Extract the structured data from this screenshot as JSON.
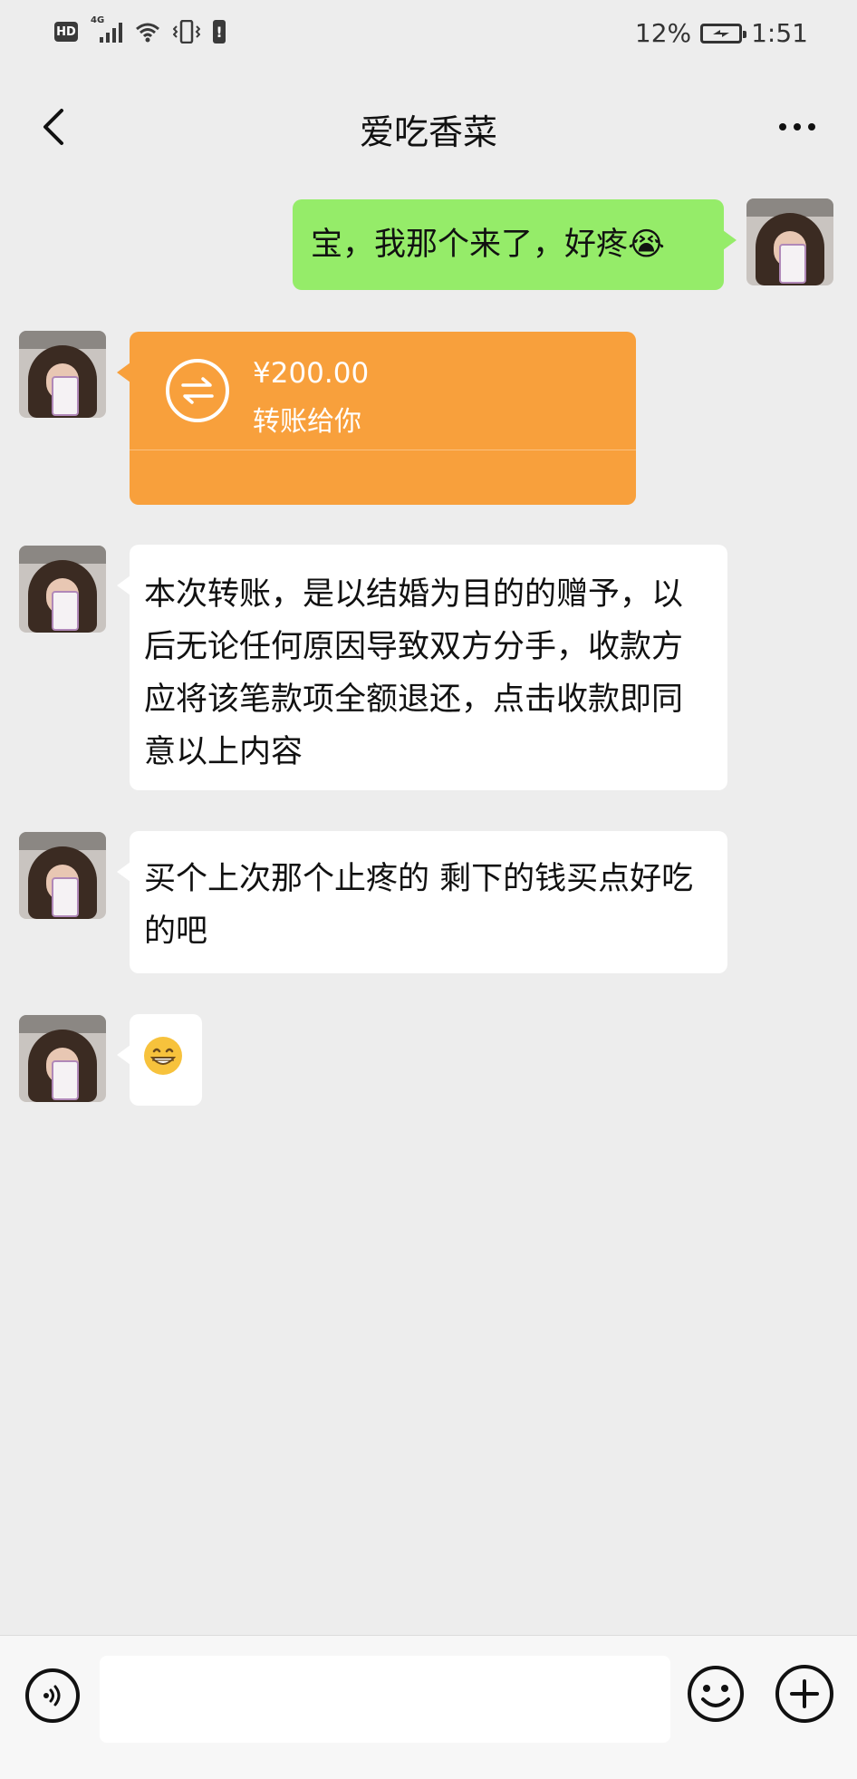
{
  "status_bar": {
    "network_badge": "HD",
    "signal_label": "4G",
    "battery_percent": "12%",
    "time": "1:51"
  },
  "nav": {
    "title": "爱吃香菜"
  },
  "messages": [
    {
      "sender": "me",
      "type": "text",
      "text": "宝，我那个来了，好疼😭"
    },
    {
      "sender": "other",
      "type": "transfer",
      "amount": "¥200.00",
      "note": "转账给你"
    },
    {
      "sender": "other",
      "type": "text",
      "text": "本次转账，是以结婚为目的的赠予，以后无论任何原因导致双方分手，收款方应将该笔款项全额退还，点击收款即同意以上内容"
    },
    {
      "sender": "other",
      "type": "text",
      "text": "买个上次那个止疼的 剩下的钱买点好吃的吧"
    },
    {
      "sender": "other",
      "type": "emoji",
      "icon": "grinning-face-emoji"
    }
  ],
  "input": {
    "placeholder": ""
  },
  "colors": {
    "background": "#ededed",
    "my_bubble": "#95ec69",
    "other_bubble": "#ffffff",
    "transfer_card": "#f8a03c"
  }
}
